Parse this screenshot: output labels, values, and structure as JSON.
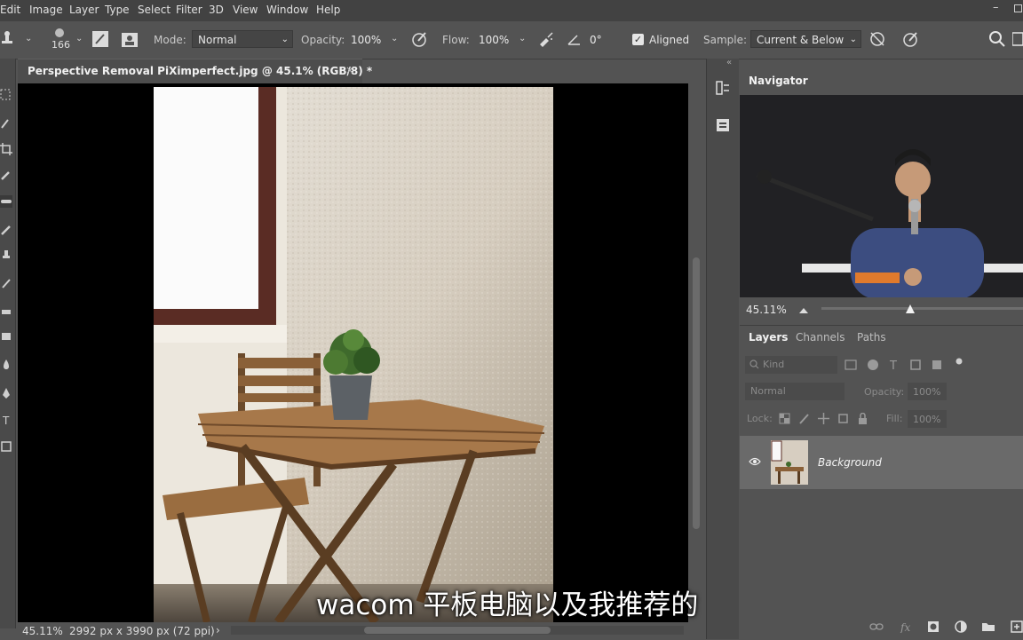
{
  "menu": {
    "items": [
      "Edit",
      "Image",
      "Layer",
      "Type",
      "Select",
      "Filter",
      "3D",
      "View",
      "Window",
      "Help"
    ]
  },
  "options": {
    "brush_size": "166",
    "mode_label": "Mode:",
    "mode_value": "Normal",
    "opacity_label": "Opacity:",
    "opacity_value": "100%",
    "flow_label": "Flow:",
    "flow_value": "100%",
    "angle_value": "0°",
    "aligned_label": "Aligned",
    "aligned_checked": true,
    "sample_label": "Sample:",
    "sample_value": "Current & Below"
  },
  "document": {
    "tab_title": "Perspective Removal PiXimperfect.jpg @ 45.1% (RGB/8) *",
    "close_glyph": "×"
  },
  "status": {
    "zoom": "45.11%",
    "dimensions": "2992 px x 3990 px (72 ppi)",
    "arrow": "›"
  },
  "navigator": {
    "title": "Navigator",
    "zoom": "45.11%",
    "collapse_glyph": "«"
  },
  "layers": {
    "tabs": [
      "Layers",
      "Channels",
      "Paths"
    ],
    "kind_placeholder": "Kind",
    "blend_mode": "Normal",
    "opacity_label": "Opacity:",
    "opacity_value": "100%",
    "lock_label": "Lock:",
    "fill_label": "Fill:",
    "fill_value": "100%",
    "items": [
      {
        "name": "Background",
        "visible": true
      }
    ]
  },
  "subtitle": "wacom 平板电脑以及我推荐的",
  "colors": {
    "ui_dark": "#424242",
    "ui_mid": "#535353",
    "selected_layer": "#6a6a6a",
    "canvas_bg": "#000000",
    "wall": "#d9d1c6",
    "wood": "#8a5e36"
  }
}
